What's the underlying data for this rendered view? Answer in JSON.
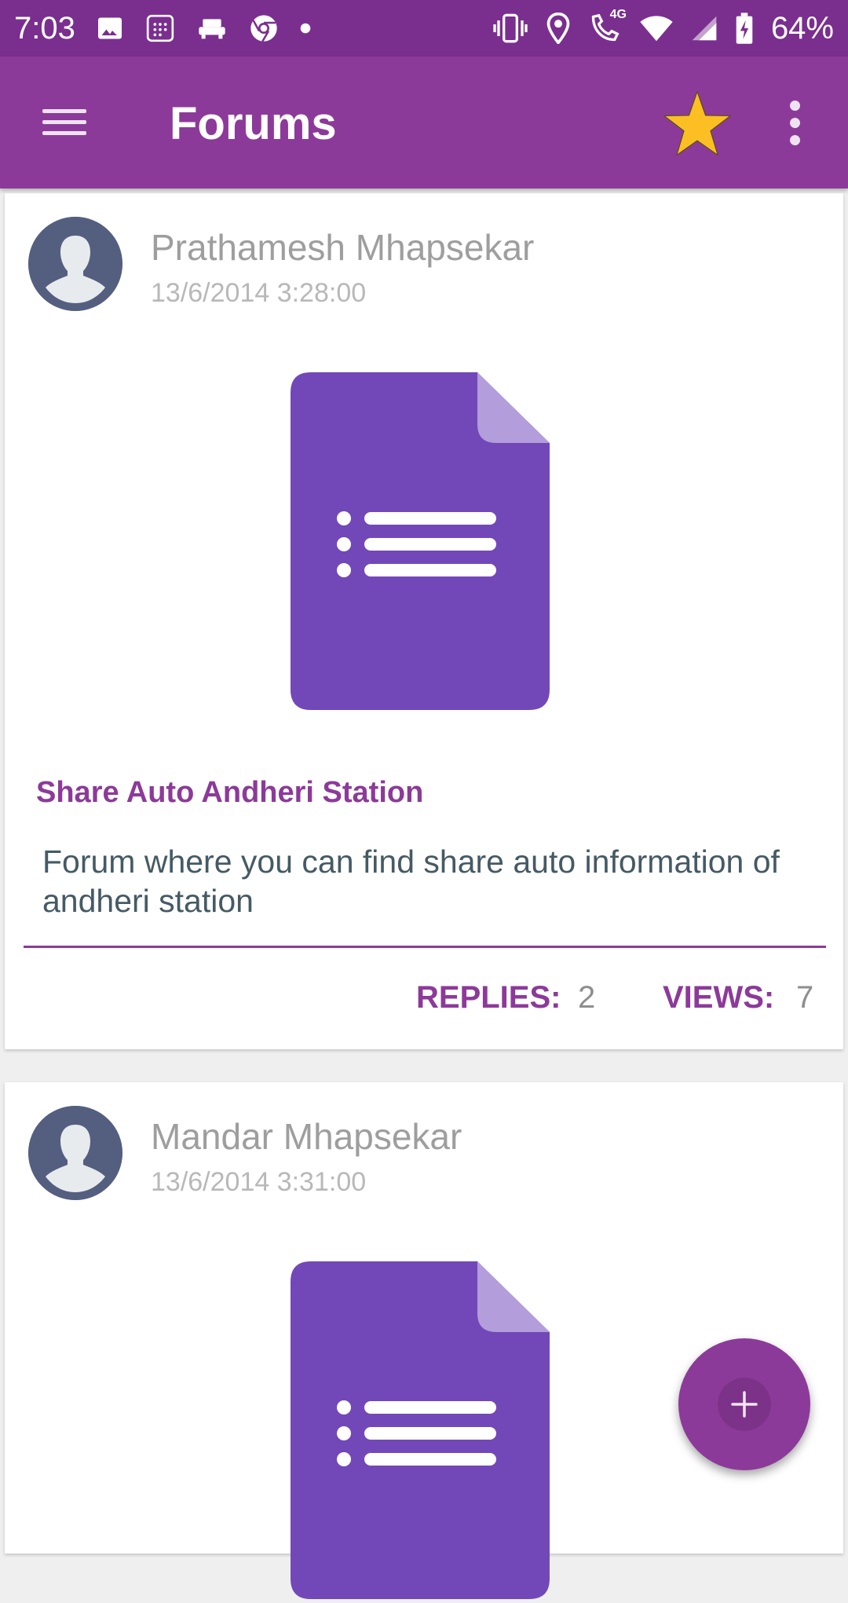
{
  "status_bar": {
    "time": "7:03",
    "battery_percent": "64%",
    "network_badge": "4G",
    "left_icons": [
      "image-icon",
      "calculator-icon",
      "car-icon",
      "chrome-icon",
      "dot-icon"
    ],
    "right_icons": [
      "vibrate-icon",
      "location-icon",
      "wifi-call-icon",
      "wifi-icon",
      "signal-icon",
      "battery-icon"
    ]
  },
  "app_bar": {
    "title": "Forums",
    "menu_icon": "hamburger-menu-icon",
    "star_icon": "star-icon",
    "overflow_icon": "more-vert-icon"
  },
  "posts": [
    {
      "author": "Prathamesh Mhapsekar",
      "date": "13/6/2014 3:28:00",
      "title": "Share Auto Andheri Station",
      "description": "Forum where you can find share auto information of andheri station",
      "replies_label": "REPLIES:",
      "replies": "2",
      "views_label": "VIEWS:",
      "views": "7"
    },
    {
      "author": "Mandar Mhapsekar",
      "date": "13/6/2014 3:31:00"
    }
  ],
  "fab": {
    "icon": "plus-icon",
    "symbol": "+"
  },
  "colors": {
    "status_bar": "#7a2f8f",
    "app_bar": "#8c3a99",
    "accent": "#8c3a99",
    "star": "#fbbf24",
    "doc_icon": "#7248b9",
    "avatar_bg": "#545f80"
  }
}
